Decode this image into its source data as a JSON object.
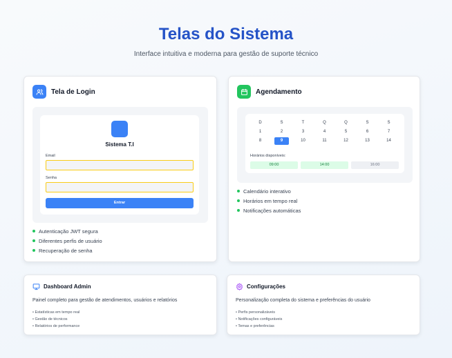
{
  "header": {
    "title": "Telas do Sistema",
    "subtitle": "Interface intuitiva e moderna para gestão de suporte técnico"
  },
  "login_card": {
    "title": "Tela de Login",
    "icon": "users-icon",
    "accent": "#3b82f6",
    "mock": {
      "app_name": "Sistema T.I",
      "email_label": "Email",
      "password_label": "Senha",
      "button_label": "Entrar"
    },
    "features": [
      "Autenticação JWT segura",
      "Diferentes perfis de usuário",
      "Recuperação de senha"
    ]
  },
  "schedule_card": {
    "title": "Agendamento",
    "icon": "calendar-icon",
    "accent": "#22c55e",
    "calendar": {
      "weekdays": [
        "D",
        "S",
        "T",
        "Q",
        "Q",
        "S",
        "S"
      ],
      "weeks": [
        [
          "1",
          "2",
          "3",
          "4",
          "5",
          "6",
          "7"
        ],
        [
          "8",
          "9",
          "10",
          "11",
          "12",
          "13",
          "14"
        ]
      ],
      "selected_day": "9",
      "slots_label": "Horários disponíveis:",
      "slots": [
        "09:00",
        "14:00",
        "16:00"
      ]
    },
    "features": [
      "Calendário interativo",
      "Horários em tempo real",
      "Notificações automáticas"
    ]
  },
  "dashboard_card": {
    "title": "Dashboard Admin",
    "icon": "monitor-icon",
    "description": "Painel completo para gestão de atendimentos, usuários e relatórios",
    "items": [
      "• Estatísticas em tempo real",
      "• Gestão de técnicos",
      "• Relatórios de performance"
    ]
  },
  "settings_card": {
    "title": "Configurações",
    "icon": "gear-icon",
    "description": "Personalização completa do sistema e preferências do usuário",
    "items": [
      "• Perfis personalizáveis",
      "• Notificações configuráveis",
      "• Temas e preferências"
    ]
  }
}
